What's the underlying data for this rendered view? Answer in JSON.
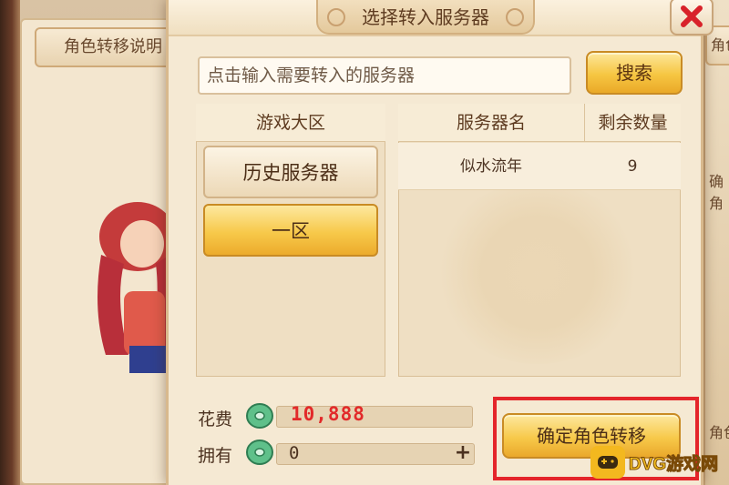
{
  "background": {
    "left_tab_label": "角色转移说明",
    "right_tab_label": "角色",
    "right_text_1": "确角",
    "right_text_2": "角色"
  },
  "dialog": {
    "title": "选择转入服务器",
    "close_icon": "close-x-icon",
    "search": {
      "placeholder": "点击输入需要转入的服务器",
      "value": "",
      "button_label": "搜索"
    },
    "zones": {
      "header": "游戏大区",
      "items": [
        {
          "label": "历史服务器",
          "selected": false
        },
        {
          "label": "一区",
          "selected": true
        }
      ]
    },
    "servers": {
      "columns": [
        "服务器名",
        "剩余数量"
      ],
      "rows": [
        {
          "name": "似水流年",
          "count": "9"
        }
      ]
    },
    "cost": {
      "label": "花费",
      "value": "10,888",
      "icon": "jade-coin-icon"
    },
    "owned": {
      "label": "拥有",
      "value": "0",
      "icon": "jade-coin-icon",
      "add_icon": "plus-icon"
    },
    "confirm_label": "确定角色转移"
  },
  "watermark": {
    "text": "DVG游戏网",
    "icon": "gamepad-icon"
  },
  "colors": {
    "accent_gold": "#f7c94a",
    "cost_red": "#e22a2a",
    "highlight_red": "#e4252a",
    "panel_bg": "#f5e9d3"
  }
}
